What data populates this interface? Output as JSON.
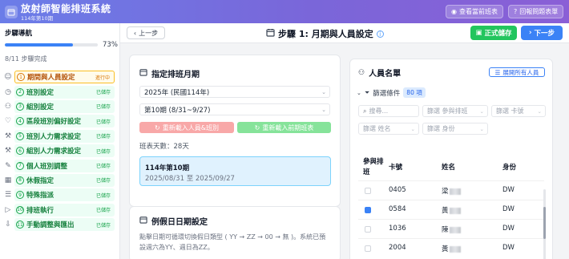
{
  "header": {
    "title": "放射師智能排班系統",
    "subtitle": "114年第10期",
    "view_button": "查看當前班表",
    "report_button": "回報問題表單"
  },
  "sidebar": {
    "title": "步驟導航",
    "progress_percent": "73%",
    "progress_fraction": 0.73,
    "completed_text": "8/11 步驟完成",
    "steps": [
      {
        "num": "1",
        "label": "期間與人員設定",
        "status": "進行中",
        "active": true,
        "icon": "person-icon"
      },
      {
        "num": "2",
        "label": "班別設定",
        "status": "已儲存",
        "icon": "clock-icon"
      },
      {
        "num": "3",
        "label": "組別設定",
        "status": "已儲存",
        "icon": "group-icon"
      },
      {
        "num": "4",
        "label": "區段班別偏好設定",
        "status": "已儲存",
        "icon": "heart-icon"
      },
      {
        "num": "5",
        "label": "班別人力需求設定",
        "status": "已儲存",
        "icon": "tool-icon"
      },
      {
        "num": "6",
        "label": "組別人力需求設定",
        "status": "已儲存",
        "icon": "tool-icon"
      },
      {
        "num": "7",
        "label": "個人班別調整",
        "status": "已儲存",
        "icon": "edit-icon"
      },
      {
        "num": "8",
        "label": "休假指定",
        "status": "已儲存",
        "icon": "calendar-icon"
      },
      {
        "num": "9",
        "label": "特殊指派",
        "status": "已儲存",
        "icon": "list-icon"
      },
      {
        "num": "10",
        "label": "排班執行",
        "status": "已儲存",
        "icon": "play-icon"
      },
      {
        "num": "11",
        "label": "手動調整與匯出",
        "status": "已儲存",
        "icon": "download-icon"
      }
    ]
  },
  "stepbar": {
    "prev_label": "上一步",
    "title": "步驟 1: 月期與人員設定",
    "save_label": "正式儲存",
    "next_label": "下一步"
  },
  "period_panel": {
    "title": "指定排班月期",
    "year_value": "2025年 (民國114年)",
    "period_value": "第10期 (8/31~9/27)",
    "reload_staff_button": "重新載入人員&班別",
    "reload_prev_button": "重新載入前期班表",
    "days_text": "班表天數：28天",
    "period_box_title": "114年第10期",
    "period_box_range": "2025/08/31 至 2025/09/27"
  },
  "holiday_panel": {
    "title": "例假日日期設定",
    "description": "點擊日期可循環切換假日類型 ( YY → ZZ → 00 → 無 )。系統已預設週六為YY、週日為ZZ。"
  },
  "staff_panel": {
    "title": "人員名單",
    "expand_button": "展開所有人員",
    "filter_label": "篩選條件",
    "filter_count": "80 項",
    "search_placeholder": "搜尋...",
    "filter_group_placeholder": "篩選 參與排班",
    "filter_card_placeholder": "篩選 卡號",
    "filter_name_placeholder": "篩選 姓名",
    "filter_role_placeholder": "篩選 身份",
    "columns": [
      "參與排班",
      "卡號",
      "姓名",
      "身份"
    ],
    "rows": [
      {
        "checked": false,
        "card": "0405",
        "name": "梁",
        "role": "DW"
      },
      {
        "checked": true,
        "card": "0584",
        "name": "黃",
        "role": "DW"
      },
      {
        "checked": false,
        "card": "1036",
        "name": "陳",
        "role": "DW"
      },
      {
        "checked": false,
        "card": "2004",
        "name": "黃",
        "role": "DW"
      }
    ]
  },
  "colors": {
    "accent": "#3b82f6",
    "success": "#22c55e",
    "active_step": "#d97706"
  }
}
